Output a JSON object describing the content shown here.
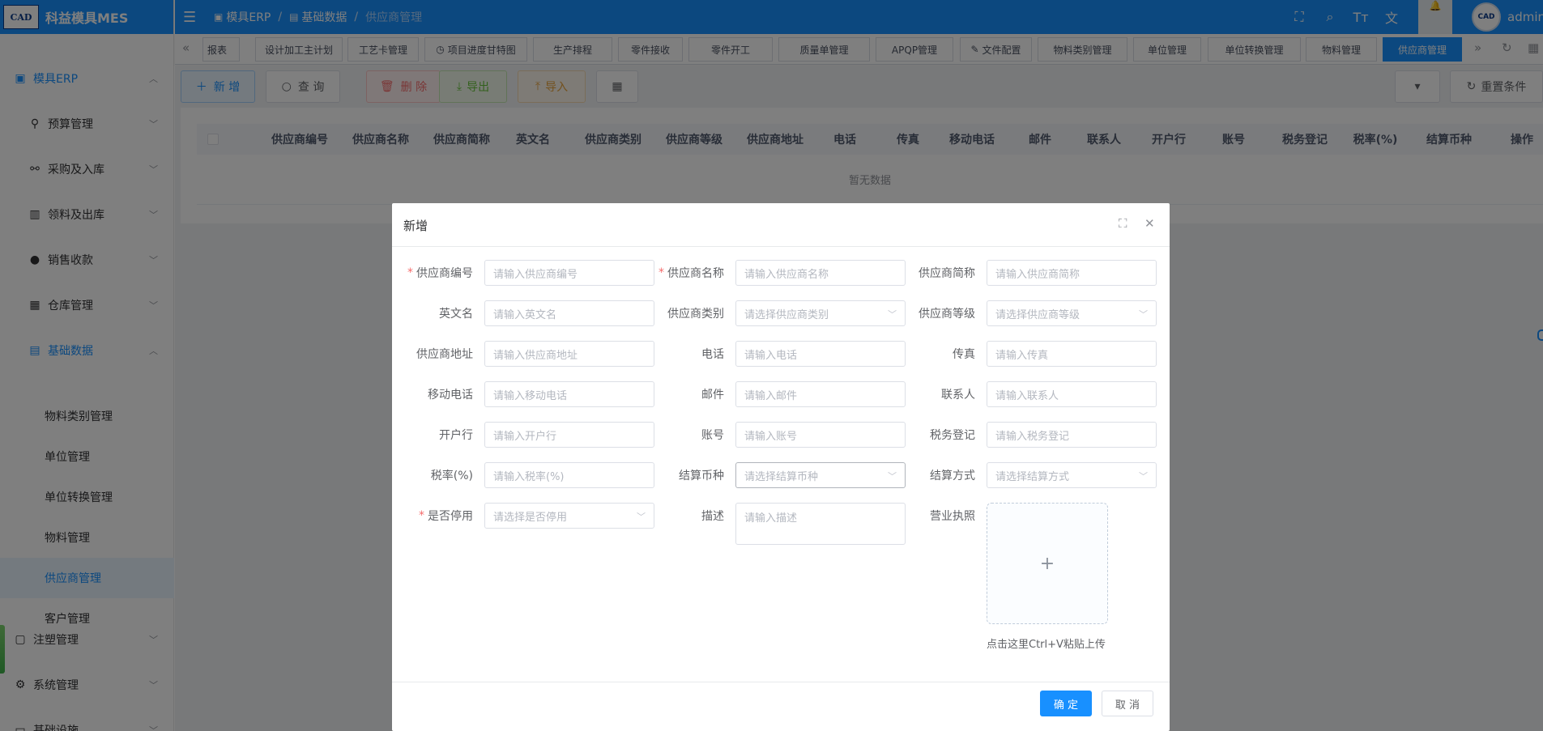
{
  "app": {
    "logo_text": "CAD",
    "title": "科益模具MES"
  },
  "sidebar": {
    "items": [
      {
        "label": "模具ERP",
        "icon": "box-icon",
        "expanded": true
      },
      {
        "label": "预算管理",
        "icon": "filter-icon"
      },
      {
        "label": "采购及入库",
        "icon": "bike-icon"
      },
      {
        "label": "领料及出库",
        "icon": "building-icon"
      },
      {
        "label": "销售收款",
        "icon": "user-icon"
      },
      {
        "label": "仓库管理",
        "icon": "calendar-icon"
      },
      {
        "label": "基础数据",
        "icon": "card-icon",
        "expanded": true
      },
      {
        "label": "注塑管理",
        "icon": "bag-icon"
      },
      {
        "label": "系统管理",
        "icon": "gear-icon"
      },
      {
        "label": "基础设施",
        "icon": "monitor-icon"
      }
    ],
    "sub_items": [
      "物料类别管理",
      "单位管理",
      "单位转换管理",
      "物料管理",
      "供应商管理",
      "客户管理"
    ],
    "active_sub": "供应商管理"
  },
  "navbar": {
    "breadcrumb": [
      "模具ERP",
      "基础数据",
      "供应商管理"
    ],
    "user": "admin",
    "avatar_text": "CAD"
  },
  "tags": [
    "报表",
    "设计加工主计划",
    "工艺卡管理",
    "项目进度甘特图",
    "生产排程",
    "零件接收",
    "零件开工",
    "质量单管理",
    "APQP管理",
    "文件配置",
    "物料类别管理",
    "单位管理",
    "单位转换管理",
    "物料管理",
    "供应商管理"
  ],
  "active_tag": "供应商管理",
  "toolbar": {
    "add": "新 增",
    "query": "查 询",
    "delete": "删 除",
    "export": "导出",
    "import": "导入",
    "reset": "重置条件"
  },
  "colors": {
    "primary": "#1890ff",
    "danger": "#f56c6c",
    "success": "#67c23a",
    "warning": "#e6a23c"
  },
  "table": {
    "columns": [
      "供应商编号",
      "供应商名称",
      "供应商简称",
      "英文名",
      "供应商类别",
      "供应商等级",
      "供应商地址",
      "电话",
      "传真",
      "移动电话",
      "邮件",
      "联系人",
      "开户行",
      "账号",
      "税务登记",
      "税率(%)",
      "结算币种",
      "操作"
    ],
    "empty_text": "暂无数据"
  },
  "dialog": {
    "title": "新增",
    "fields": [
      {
        "label": "供应商编号",
        "placeholder": "请输入供应商编号",
        "required": true,
        "type": "input"
      },
      {
        "label": "供应商名称",
        "placeholder": "请输入供应商名称",
        "required": true,
        "type": "input"
      },
      {
        "label": "供应商简称",
        "placeholder": "请输入供应商简称",
        "required": false,
        "type": "input"
      },
      {
        "label": "英文名",
        "placeholder": "请输入英文名",
        "required": false,
        "type": "input"
      },
      {
        "label": "供应商类别",
        "placeholder": "请选择供应商类别",
        "required": false,
        "type": "select"
      },
      {
        "label": "供应商等级",
        "placeholder": "请选择供应商等级",
        "required": false,
        "type": "select"
      },
      {
        "label": "供应商地址",
        "placeholder": "请输入供应商地址",
        "required": false,
        "type": "input"
      },
      {
        "label": "电话",
        "placeholder": "请输入电话",
        "required": false,
        "type": "input"
      },
      {
        "label": "传真",
        "placeholder": "请输入传真",
        "required": false,
        "type": "input"
      },
      {
        "label": "移动电话",
        "placeholder": "请输入移动电话",
        "required": false,
        "type": "input"
      },
      {
        "label": "邮件",
        "placeholder": "请输入邮件",
        "required": false,
        "type": "input"
      },
      {
        "label": "联系人",
        "placeholder": "请输入联系人",
        "required": false,
        "type": "input"
      },
      {
        "label": "开户行",
        "placeholder": "请输入开户行",
        "required": false,
        "type": "input"
      },
      {
        "label": "账号",
        "placeholder": "请输入账号",
        "required": false,
        "type": "input"
      },
      {
        "label": "税务登记",
        "placeholder": "请输入税务登记",
        "required": false,
        "type": "input"
      },
      {
        "label": "税率(%)",
        "placeholder": "请输入税率(%)",
        "required": false,
        "type": "input"
      },
      {
        "label": "结算币种",
        "placeholder": "请选择结算币种",
        "required": false,
        "type": "select"
      },
      {
        "label": "结算方式",
        "placeholder": "请选择结算方式",
        "required": false,
        "type": "select"
      },
      {
        "label": "是否停用",
        "placeholder": "请选择是否停用",
        "required": true,
        "type": "select"
      },
      {
        "label": "描述",
        "placeholder": "请输入描述",
        "required": false,
        "type": "textarea"
      },
      {
        "label": "营业执照",
        "placeholder": "",
        "required": false,
        "type": "upload"
      }
    ],
    "upload_tip": "点击这里Ctrl+V粘贴上传",
    "ok": "确 定",
    "cancel": "取 消"
  }
}
